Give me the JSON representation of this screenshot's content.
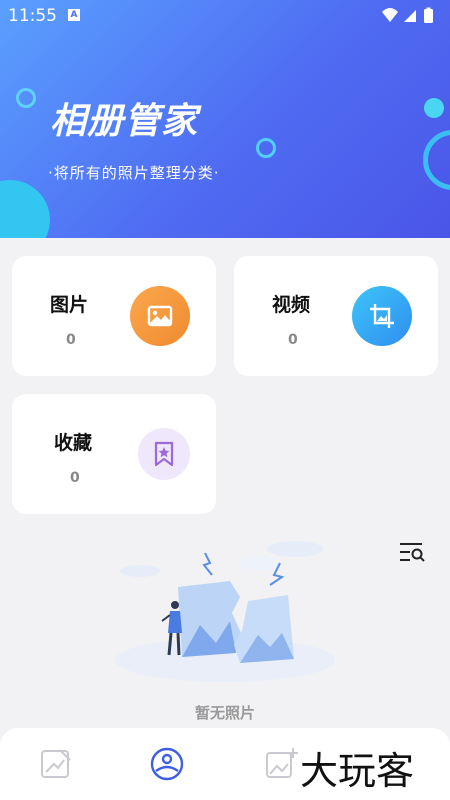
{
  "status": {
    "time": "11:55",
    "sim_label": "A"
  },
  "hero": {
    "title": "相册管家",
    "subtitle": "·将所有的照片整理分类·"
  },
  "cards": {
    "pictures": {
      "label": "图片",
      "count": "0"
    },
    "videos": {
      "label": "视频",
      "count": "0"
    },
    "favorites": {
      "label": "收藏",
      "count": "0"
    }
  },
  "empty": {
    "text": "暂无照片"
  },
  "watermark": "大玩客",
  "colors": {
    "accent": "#4f6cf2",
    "orange": "#f79a3a",
    "blue": "#3aa8f7",
    "lavender": "#efe7fb"
  }
}
